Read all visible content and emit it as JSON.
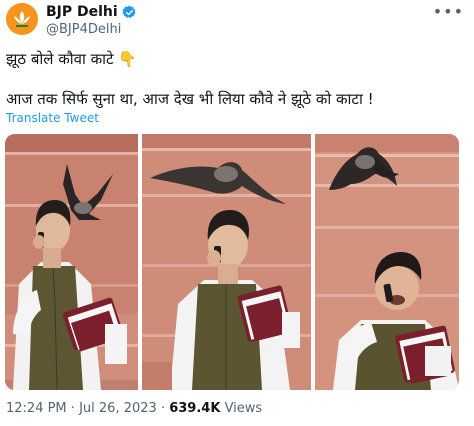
{
  "account": {
    "display_name": "BJP Delhi",
    "handle": "@BJP4Delhi",
    "avatar_icon": "lotus-logo",
    "verified_icon": "verified-badge-icon",
    "more_icon": "more-options-icon"
  },
  "tweet": {
    "line1": "झूठ बोले कौवा काटे",
    "line1_emoji": "👇",
    "line2": "आज तक सिर्फ सुना था, आज देख भी लिया कौवे ने झूठे को काटा !",
    "translate_label": "Translate Tweet"
  },
  "media": {
    "panels": [
      "photo-1",
      "photo-2",
      "photo-3"
    ]
  },
  "meta": {
    "time": "12:24 PM",
    "separator": "·",
    "date": "Jul 26, 2023",
    "views_count": "639.4K",
    "views_label": "Views"
  },
  "colors": {
    "accent": "#1d9bf0",
    "secondary_text": "#536471",
    "brand_orange": "#f7941d"
  }
}
